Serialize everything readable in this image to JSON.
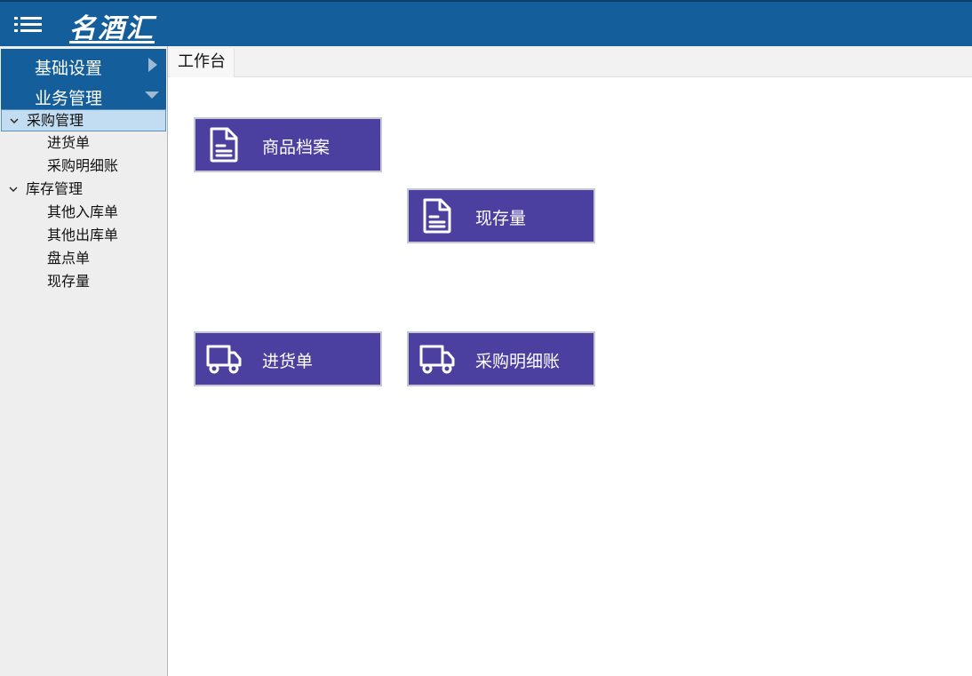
{
  "header": {
    "brand": "名酒汇",
    "menu_icon": "hamburger-list-icon",
    "background": "#135e9b"
  },
  "sidebar": {
    "groups": [
      {
        "label": "基础设置",
        "state": "collapsed"
      },
      {
        "label": "业务管理",
        "state": "expanded"
      }
    ],
    "tree": [
      {
        "label": "采购管理",
        "type": "folder",
        "selected": true
      },
      {
        "label": "进货单",
        "type": "leaf"
      },
      {
        "label": "采购明细账",
        "type": "leaf"
      },
      {
        "label": "库存管理",
        "type": "folder"
      },
      {
        "label": "其他入库单",
        "type": "leaf"
      },
      {
        "label": "其他出库单",
        "type": "leaf"
      },
      {
        "label": "盘点单",
        "type": "leaf"
      },
      {
        "label": "现存量",
        "type": "leaf"
      }
    ]
  },
  "tabs": [
    {
      "label": "工作台",
      "active": true
    }
  ],
  "tiles": [
    {
      "label": "商品档案",
      "icon": "document-icon"
    },
    {
      "label": "现存量",
      "icon": "document-icon"
    },
    {
      "label": "进货单",
      "icon": "truck-icon"
    },
    {
      "label": "采购明细账",
      "icon": "truck-icon"
    }
  ],
  "colors": {
    "accent": "#135e9b",
    "tile": "#4b3fa0",
    "selected_row": "#c2dcf1"
  }
}
